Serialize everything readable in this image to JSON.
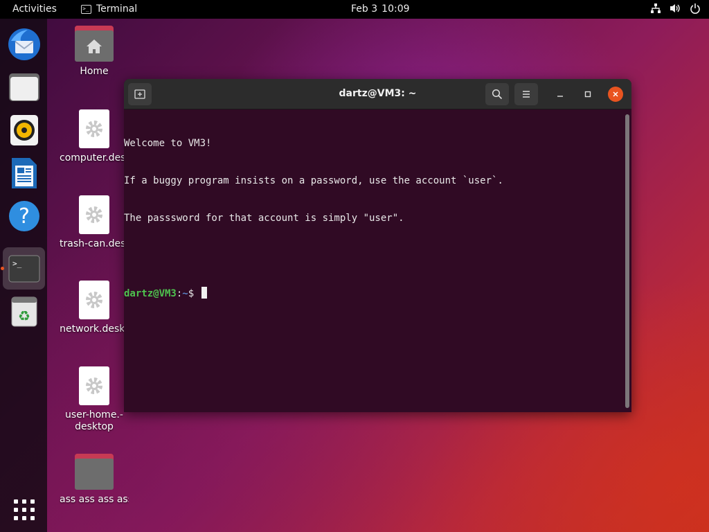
{
  "topbar": {
    "activities": "Activities",
    "app_name": "Terminal",
    "date": "Feb 3",
    "time": "10:09"
  },
  "dock": {
    "items": [
      "thunderbird-icon",
      "files-icon",
      "rhythmbox-icon",
      "libreoffice-writer-icon",
      "help-icon",
      "terminal-icon",
      "trash-icon"
    ],
    "active": "terminal-icon",
    "show_apps": "grid-icon"
  },
  "desktop": {
    "icons": [
      {
        "label": "Home"
      },
      {
        "label": "computer.deskt"
      },
      {
        "label": "trash-can.deskt"
      },
      {
        "label": "network.deskt"
      },
      {
        "label_line1": "user-home.-",
        "label_line2": "desktop"
      },
      {
        "label": "ass ass ass ass"
      }
    ]
  },
  "terminal": {
    "title": "dartz@VM3: ~",
    "lines": [
      "Welcome to VM3!",
      "If a buggy program insists on a password, use the account `user`.",
      "The passsword for that account is simply \"user\"."
    ],
    "prompt_user": "dartz@VM3",
    "prompt_sep": ":",
    "prompt_path": "~",
    "prompt_symbol": "$ "
  },
  "colors": {
    "terminal_bg": "#300a24",
    "prompt_user": "#4ec24e",
    "prompt_path": "#5a86c8",
    "close_button": "#e95420",
    "accent": "#e95420"
  }
}
